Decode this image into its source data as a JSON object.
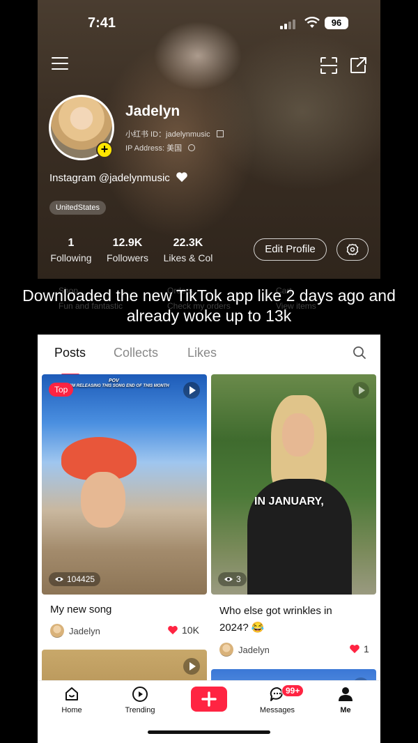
{
  "status": {
    "time": "7:41",
    "battery": "96"
  },
  "profile": {
    "name": "Jadelyn",
    "id_line": "小红书 ID：jadelynmusic",
    "ip_line": "IP Address: 美国",
    "bio": "Instagram @jadelynmusic",
    "tag": "UnitedStates"
  },
  "stats": [
    {
      "value": "1",
      "label": "Following"
    },
    {
      "value": "12.9K",
      "label": "Followers"
    },
    {
      "value": "22.3K",
      "label": "Likes & Col"
    }
  ],
  "actions": {
    "edit": "Edit Profile"
  },
  "ghost": {
    "c1a": "Shop",
    "c1b": "Fun and fantastic",
    "c2a": "Orders",
    "c2b": "Check my orders",
    "c3a": "Cart",
    "c3b": "View items"
  },
  "caption": {
    "line1": "Downloaded the new TikTok app like 2 days ago and",
    "line2": "already woke up to 13k"
  },
  "tabs": [
    "Posts",
    "Collects",
    "Likes"
  ],
  "posts": [
    {
      "badge": "Top",
      "pov": "POV",
      "overlay": "I'M RELEASING THIS SONG END OF THIS MONTH",
      "views": "104425",
      "title": "My new song",
      "author": "Jadelyn",
      "likes": "10K"
    },
    {
      "overlay": "IN JANUARY,",
      "views": "3",
      "title1": "Who else got wrinkles in",
      "title2": "2024? 😂",
      "author": "Jadelyn",
      "likes": "1"
    }
  ],
  "nav": {
    "home": "Home",
    "trending": "Trending",
    "messages": "Messages",
    "badge": "99+",
    "me": "Me"
  },
  "colors": {
    "accent": "#ff2442",
    "header": "#3b2f24"
  }
}
